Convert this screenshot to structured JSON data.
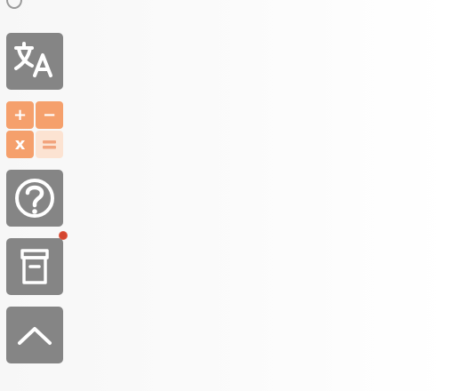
{
  "toolbar": {
    "items": [
      {
        "id": "translate",
        "icon": "translate-icon"
      },
      {
        "id": "calculator",
        "icon": "calculator-icon",
        "keys": [
          "+",
          "−",
          "x",
          "="
        ]
      },
      {
        "id": "help",
        "icon": "question-circle-icon"
      },
      {
        "id": "archive",
        "icon": "archive-box-icon",
        "has_notification": true
      },
      {
        "id": "scroll-to-top",
        "icon": "chevron-up-icon"
      }
    ]
  },
  "colors": {
    "button_gray": "#858585",
    "calculator_orange": "#f5a06c",
    "calculator_light": "#fce3d2",
    "notification_red": "#d4452f",
    "icon_white": "#ffffff"
  }
}
